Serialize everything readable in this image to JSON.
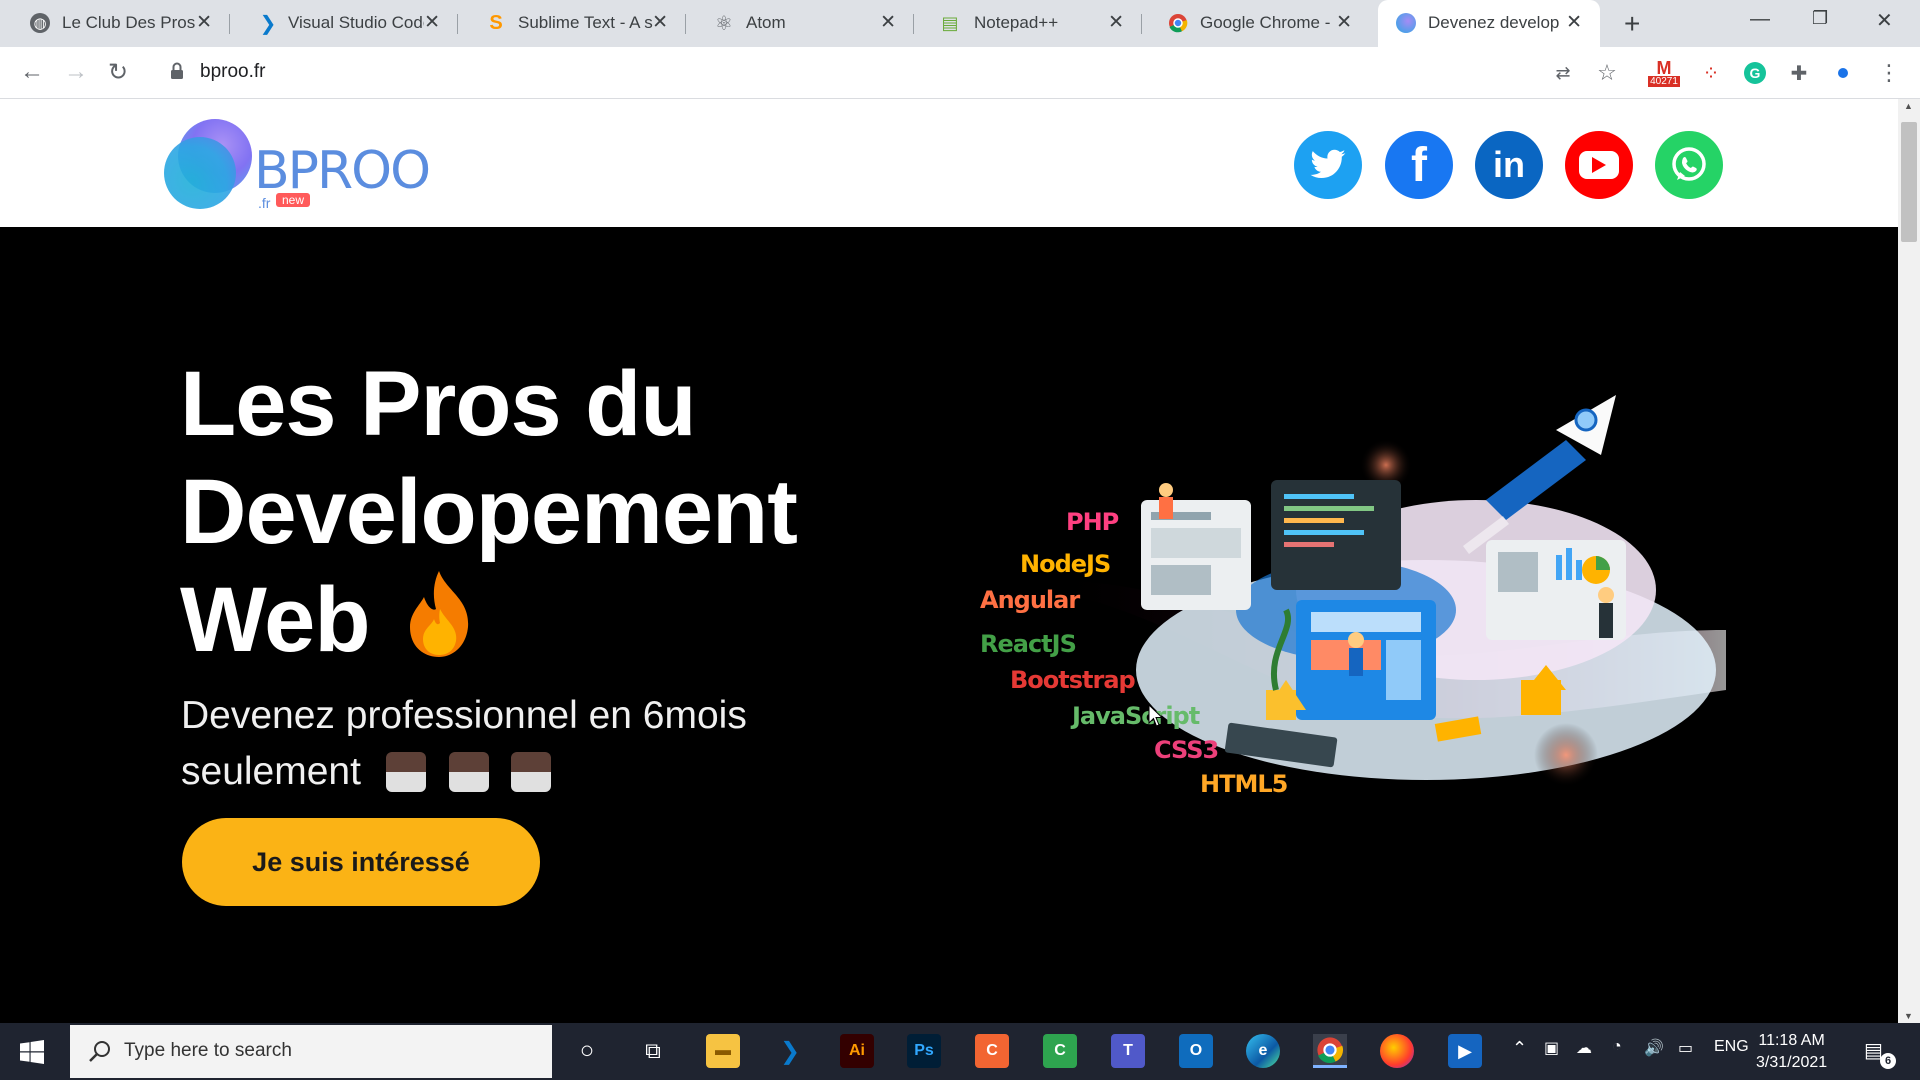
{
  "browser": {
    "tabs": [
      {
        "label": "Le Club Des Pros",
        "icon": "globe-icon",
        "active": false
      },
      {
        "label": "Visual Studio Code",
        "icon": "vscode-icon",
        "active": false
      },
      {
        "label": "Sublime Text - A s",
        "icon": "sublime-icon",
        "active": false
      },
      {
        "label": "Atom",
        "icon": "atom-icon",
        "active": false
      },
      {
        "label": "Notepad++",
        "icon": "notepad-icon",
        "active": false
      },
      {
        "label": "Google Chrome -",
        "icon": "chrome-icon",
        "active": false
      },
      {
        "label": "Devenez develope",
        "icon": "bproo-icon",
        "active": true
      }
    ],
    "url": "bproo.fr",
    "gmail_badge": "40271"
  },
  "site": {
    "logo_text": "BPROO",
    "logo_suffix": ".fr",
    "logo_badge": "new",
    "social": [
      {
        "name": "twitter",
        "color": "#1da1f2"
      },
      {
        "name": "facebook",
        "color": "#1877f2"
      },
      {
        "name": "linkedin",
        "color": "#0a66c2"
      },
      {
        "name": "youtube",
        "color": "#ff0000"
      },
      {
        "name": "whatsapp",
        "color": "#25d366"
      }
    ],
    "hero": {
      "title_line1": "Les Pros du",
      "title_line2": "Developement",
      "title_line3": "Web",
      "title_emoji": "🔥",
      "subtitle_line1": "Devenez professionnel en 6mois",
      "subtitle_line2": "seulement",
      "cta_label": "Je suis intéressé"
    },
    "tech_labels": [
      "PHP",
      "NodeJS",
      "Angular",
      "ReactJS",
      "Bootstrap",
      "JavaScript",
      "CSS3",
      "HTML5"
    ]
  },
  "taskbar": {
    "search_placeholder": "Type here to search",
    "language": "ENG",
    "time": "11:18 AM",
    "date": "3/31/2021",
    "notification_count": "6"
  }
}
